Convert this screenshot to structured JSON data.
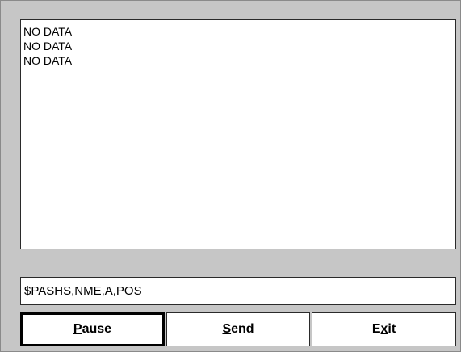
{
  "output": {
    "lines": [
      "NO DATA",
      "NO DATA",
      "NO DATA"
    ]
  },
  "command": {
    "value": "$PASHS,NME,A,POS"
  },
  "buttons": {
    "pause": {
      "mnemonic": "P",
      "rest": "ause"
    },
    "send": {
      "mnemonic": "S",
      "rest": "end"
    },
    "exit": {
      "before": "E",
      "mnemonic": "x",
      "rest": "it"
    }
  }
}
